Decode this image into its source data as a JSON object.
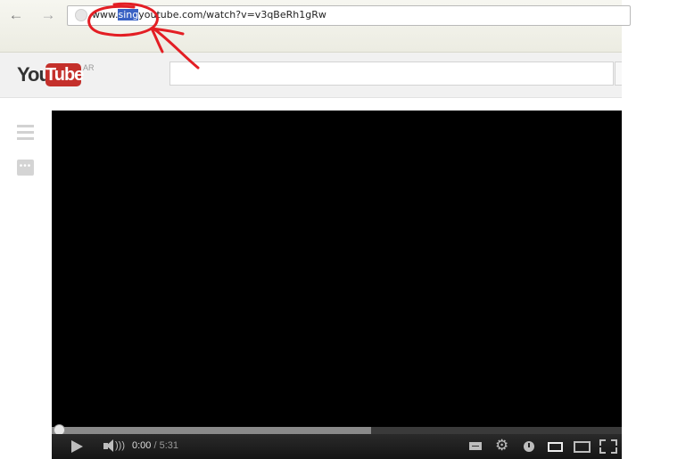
{
  "browser": {
    "back_icon": "back-arrow-icon",
    "forward_icon": "forward-arrow-icon",
    "address_bar": {
      "url_prefix": "www.",
      "url_highlight": "sing",
      "url_suffix": "youtube.com/watch?v=v3qBeRh1gRw",
      "site_icon": "globe-icon"
    }
  },
  "youtube": {
    "logo": {
      "you": "You",
      "tube": "Tube",
      "region": "AR"
    },
    "search": {
      "placeholder": ""
    },
    "guide_icon": "hamburger-icon",
    "more_icon": "more-icon",
    "brand_red": "#c4302b"
  },
  "player": {
    "time": {
      "current": "0:00",
      "separator": "/",
      "duration": "5:31"
    },
    "progress": {
      "played": 0,
      "loaded": 0.56
    },
    "icons": [
      "play-icon",
      "volume-icon",
      "captions-icon",
      "settings-icon",
      "watch-later-icon",
      "small-player-icon",
      "large-player-icon",
      "fullscreen-icon"
    ]
  },
  "annotation": {
    "color": "#e31e24",
    "shape": "circle-with-arrow"
  }
}
